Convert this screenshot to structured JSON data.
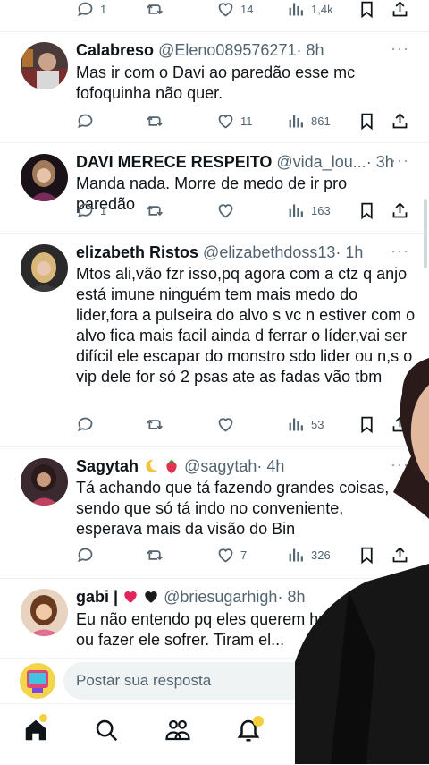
{
  "tweets": [
    {
      "name": "",
      "handle": "",
      "time": "",
      "text": "",
      "stats": {
        "replies": "1",
        "retweets": "",
        "likes": "14",
        "views": "1,4k"
      }
    },
    {
      "name": "Calabreso",
      "handle": "@Eleno089576271",
      "time": "· 8h",
      "text": "Mas ir com o Davi ao paredão esse mc fofoquinha não quer.",
      "stats": {
        "replies": "",
        "retweets": "",
        "likes": "11",
        "views": "861"
      }
    },
    {
      "name": "DAVI MERECE RESPEITO",
      "handle": "@vida_lou...",
      "time": "· 3h",
      "text": "Manda nada. Morre de medo de ir pro paredão",
      "stats": {
        "replies": "1",
        "retweets": "",
        "likes": "",
        "views": "163"
      }
    },
    {
      "name": "elizabeth Ristos",
      "handle": "@elizabethdoss13",
      "time": "· 1h",
      "text": "Mtos ali,vão fzr isso,pq agora com a ctz q anjo está imune ninguém tem mais medo do lider,fora a pulseira do alvo s vc n estiver com o alvo fica mais facil ainda d ferrar o líder,vai ser difícil ele escapar do monstro sdo lider ou n,s o vip dele for só 2 psas ate as fadas vão tbm",
      "stats": {
        "replies": "",
        "retweets": "",
        "likes": "",
        "views": "53"
      }
    },
    {
      "name": "Sagytah",
      "handle": "@sagytah",
      "time": "· 4h",
      "text": "Tá achando que tá fazendo grandes coisas, sendo que só tá indo no conveniente, esperava mais da visão do Bin",
      "stats": {
        "replies": "",
        "retweets": "",
        "likes": "7",
        "views": "326"
      }
    },
    {
      "name": "gabi |",
      "handle": "@briesugarhigh",
      "time": "· 8h",
      "text": "Eu não entendo pq eles querem humil... Davi ou fazer ele sofrer. Tiram el..."
    }
  ],
  "reply_bar": {
    "placeholder": "Postar sua resposta"
  },
  "nav": {
    "icons": [
      "home-icon",
      "search-icon",
      "communities-icon",
      "notifications-icon"
    ]
  },
  "colors": {
    "text": "#0f1419",
    "secondary": "#536471",
    "divider": "#eff3f4",
    "notification_dot": "#f4d03f",
    "heart_emoji": "#e0245e"
  }
}
